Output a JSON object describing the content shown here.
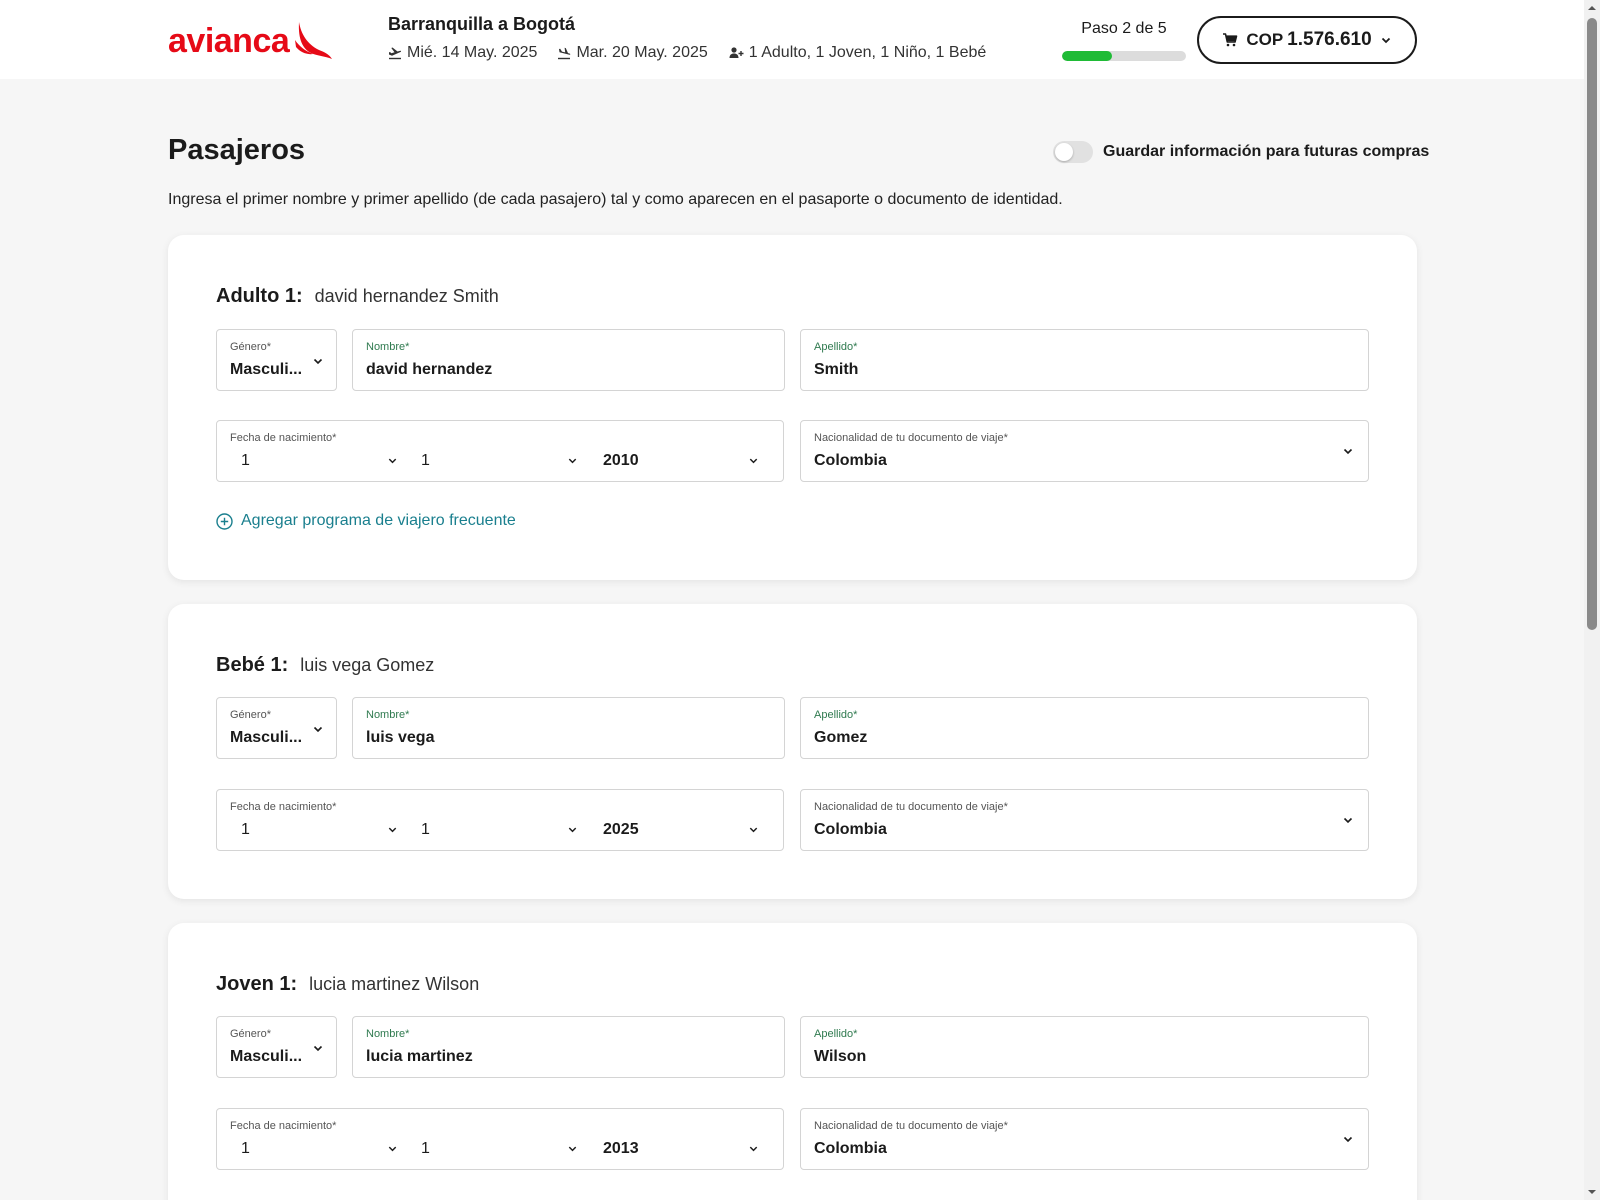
{
  "header": {
    "brand": "avianca",
    "route": "Barranquilla a Bogotá",
    "departure_date": "Mié. 14 May. 2025",
    "return_date": "Mar. 20 May. 2025",
    "passengers_summary": "1 Adulto, 1 Joven, 1 Niño, 1 Bebé",
    "step_label": "Paso 2 de 5",
    "progress_fraction": 0.4,
    "cart_currency": "COP",
    "cart_amount": "1.576.610"
  },
  "page": {
    "title": "Pasajeros",
    "save_toggle_label": "Guardar información para futuras compras",
    "instructions": "Ingresa el primer nombre y primer apellido (de cada pasajero) tal y como aparecen en el pasaporte o documento de identidad."
  },
  "labels": {
    "gender": "Género*",
    "first_name": "Nombre*",
    "last_name": "Apellido*",
    "birth_date": "Fecha de nacimiento*",
    "nationality": "Nacionalidad de tu documento de viaje*",
    "frequent_flyer": "Agregar programa de viajero frecuente"
  },
  "passengers": [
    {
      "type": "Adulto 1:",
      "full_name": "david hernandez Smith",
      "gender": "Masculi...",
      "first_name": "david hernandez",
      "last_name": "Smith",
      "birth_day": "1",
      "birth_month": "1",
      "birth_year": "2010",
      "nationality": "Colombia"
    },
    {
      "type": "Bebé 1:",
      "full_name": "luis vega Gomez",
      "gender": "Masculi...",
      "first_name": "luis vega",
      "last_name": "Gomez",
      "birth_day": "1",
      "birth_month": "1",
      "birth_year": "2025",
      "nationality": "Colombia"
    },
    {
      "type": "Joven 1:",
      "full_name": "lucia martinez Wilson",
      "gender": "Masculi...",
      "first_name": "lucia martinez",
      "last_name": "Wilson",
      "birth_day": "1",
      "birth_month": "1",
      "birth_year": "2013",
      "nationality": "Colombia"
    }
  ],
  "colors": {
    "brand_red": "#e60a17",
    "progress_green": "#1fbb36",
    "link_teal": "#1a7f8e"
  }
}
